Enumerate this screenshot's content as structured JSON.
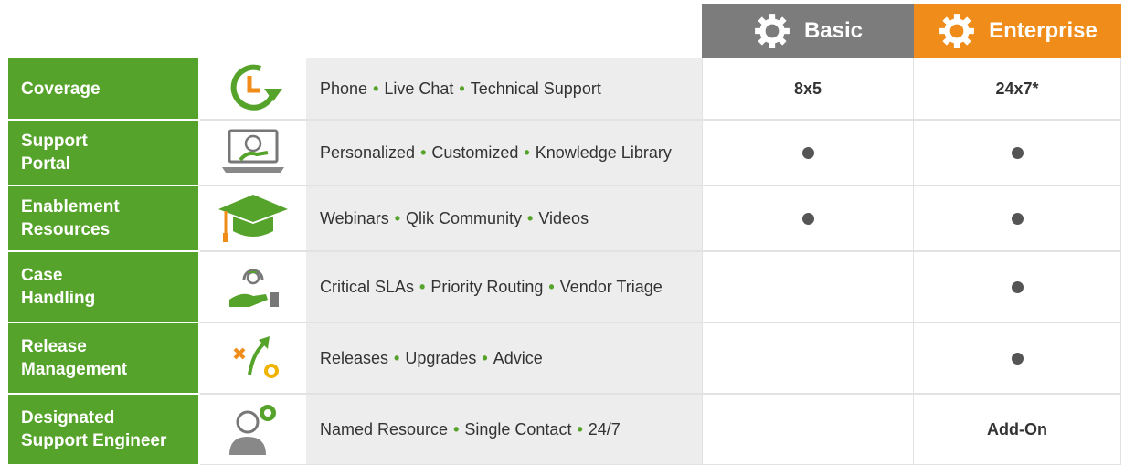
{
  "colors": {
    "green": "#55a32a",
    "orange": "#f08c1a",
    "gray_header": "#7c7c7c",
    "feature_bg": "#ededed"
  },
  "headers": {
    "basic": "Basic",
    "enterprise": "Enterprise"
  },
  "rows": [
    {
      "label": "Coverage",
      "icon": "clock-arrow-icon",
      "features": [
        "Phone",
        "Live Chat",
        "Technical Support"
      ],
      "basic": "8x5",
      "enterprise": "24x7*"
    },
    {
      "label": "Support\nPortal",
      "icon": "laptop-support-icon",
      "features": [
        "Personalized",
        "Customized",
        "Knowledge Library"
      ],
      "basic": "●",
      "enterprise": "●"
    },
    {
      "label": "Enablement\nResources",
      "icon": "graduation-cap-icon",
      "features": [
        "Webinars",
        "Qlik Community",
        "Videos"
      ],
      "basic": "●",
      "enterprise": "●"
    },
    {
      "label": "Case\nHandling",
      "icon": "hand-headset-icon",
      "features": [
        "Critical SLAs",
        "Priority Routing",
        "Vendor Triage"
      ],
      "basic": "",
      "enterprise": "●"
    },
    {
      "label": "Release\nManagement",
      "icon": "strategy-arrow-icon",
      "features": [
        "Releases",
        "Upgrades",
        "Advice"
      ],
      "basic": "",
      "enterprise": "●"
    },
    {
      "label": "Designated\nSupport Engineer",
      "icon": "engineer-badge-icon",
      "features": [
        "Named Resource",
        "Single Contact",
        "24/7"
      ],
      "basic": "",
      "enterprise": "Add-On"
    }
  ]
}
